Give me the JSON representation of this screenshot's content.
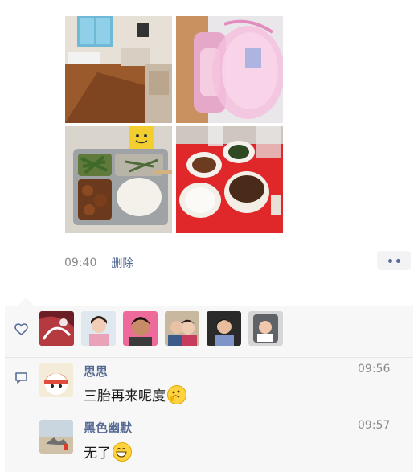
{
  "post": {
    "caption_cut": "",
    "time": "09:40",
    "delete_label": "删除",
    "photos": [
      "hospital-room-photo",
      "baby-bath-photo",
      "meal-tray-photo",
      "soup-tray-photo"
    ]
  },
  "likes": {
    "icon": "heart-icon",
    "avatars": [
      "liker-1",
      "liker-2",
      "liker-3",
      "liker-4",
      "liker-5",
      "liker-6"
    ]
  },
  "comments": [
    {
      "name": "思思",
      "time": "09:56",
      "text": "三胎再来呢度",
      "emoji": "thinking-emoji"
    },
    {
      "name": "黑色幽默",
      "time": "09:57",
      "text": "无了",
      "emoji": "grinning-emoji"
    }
  ],
  "colors": {
    "link": "#576b95",
    "panel": "#f7f7f7",
    "time": "#8a8a8a"
  }
}
